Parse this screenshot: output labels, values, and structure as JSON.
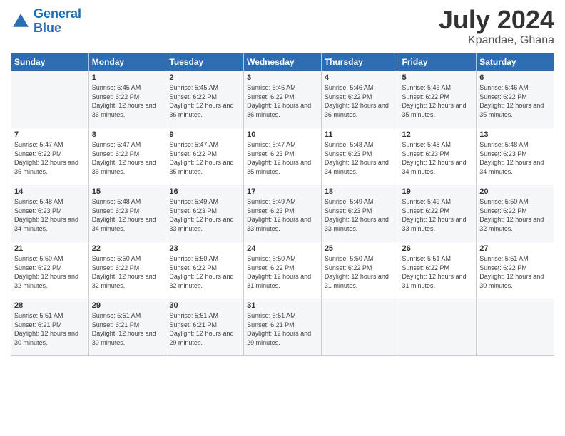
{
  "logo": {
    "line1": "General",
    "line2": "Blue"
  },
  "title": "July 2024",
  "location": "Kpandae, Ghana",
  "days_header": [
    "Sunday",
    "Monday",
    "Tuesday",
    "Wednesday",
    "Thursday",
    "Friday",
    "Saturday"
  ],
  "weeks": [
    [
      {
        "day": "",
        "sunrise": "",
        "sunset": "",
        "daylight": ""
      },
      {
        "day": "1",
        "sunrise": "Sunrise: 5:45 AM",
        "sunset": "Sunset: 6:22 PM",
        "daylight": "Daylight: 12 hours and 36 minutes."
      },
      {
        "day": "2",
        "sunrise": "Sunrise: 5:45 AM",
        "sunset": "Sunset: 6:22 PM",
        "daylight": "Daylight: 12 hours and 36 minutes."
      },
      {
        "day": "3",
        "sunrise": "Sunrise: 5:46 AM",
        "sunset": "Sunset: 6:22 PM",
        "daylight": "Daylight: 12 hours and 36 minutes."
      },
      {
        "day": "4",
        "sunrise": "Sunrise: 5:46 AM",
        "sunset": "Sunset: 6:22 PM",
        "daylight": "Daylight: 12 hours and 36 minutes."
      },
      {
        "day": "5",
        "sunrise": "Sunrise: 5:46 AM",
        "sunset": "Sunset: 6:22 PM",
        "daylight": "Daylight: 12 hours and 35 minutes."
      },
      {
        "day": "6",
        "sunrise": "Sunrise: 5:46 AM",
        "sunset": "Sunset: 6:22 PM",
        "daylight": "Daylight: 12 hours and 35 minutes."
      }
    ],
    [
      {
        "day": "7",
        "sunrise": "Sunrise: 5:47 AM",
        "sunset": "Sunset: 6:22 PM",
        "daylight": "Daylight: 12 hours and 35 minutes."
      },
      {
        "day": "8",
        "sunrise": "Sunrise: 5:47 AM",
        "sunset": "Sunset: 6:22 PM",
        "daylight": "Daylight: 12 hours and 35 minutes."
      },
      {
        "day": "9",
        "sunrise": "Sunrise: 5:47 AM",
        "sunset": "Sunset: 6:22 PM",
        "daylight": "Daylight: 12 hours and 35 minutes."
      },
      {
        "day": "10",
        "sunrise": "Sunrise: 5:47 AM",
        "sunset": "Sunset: 6:23 PM",
        "daylight": "Daylight: 12 hours and 35 minutes."
      },
      {
        "day": "11",
        "sunrise": "Sunrise: 5:48 AM",
        "sunset": "Sunset: 6:23 PM",
        "daylight": "Daylight: 12 hours and 34 minutes."
      },
      {
        "day": "12",
        "sunrise": "Sunrise: 5:48 AM",
        "sunset": "Sunset: 6:23 PM",
        "daylight": "Daylight: 12 hours and 34 minutes."
      },
      {
        "day": "13",
        "sunrise": "Sunrise: 5:48 AM",
        "sunset": "Sunset: 6:23 PM",
        "daylight": "Daylight: 12 hours and 34 minutes."
      }
    ],
    [
      {
        "day": "14",
        "sunrise": "Sunrise: 5:48 AM",
        "sunset": "Sunset: 6:23 PM",
        "daylight": "Daylight: 12 hours and 34 minutes."
      },
      {
        "day": "15",
        "sunrise": "Sunrise: 5:48 AM",
        "sunset": "Sunset: 6:23 PM",
        "daylight": "Daylight: 12 hours and 34 minutes."
      },
      {
        "day": "16",
        "sunrise": "Sunrise: 5:49 AM",
        "sunset": "Sunset: 6:23 PM",
        "daylight": "Daylight: 12 hours and 33 minutes."
      },
      {
        "day": "17",
        "sunrise": "Sunrise: 5:49 AM",
        "sunset": "Sunset: 6:23 PM",
        "daylight": "Daylight: 12 hours and 33 minutes."
      },
      {
        "day": "18",
        "sunrise": "Sunrise: 5:49 AM",
        "sunset": "Sunset: 6:23 PM",
        "daylight": "Daylight: 12 hours and 33 minutes."
      },
      {
        "day": "19",
        "sunrise": "Sunrise: 5:49 AM",
        "sunset": "Sunset: 6:22 PM",
        "daylight": "Daylight: 12 hours and 33 minutes."
      },
      {
        "day": "20",
        "sunrise": "Sunrise: 5:50 AM",
        "sunset": "Sunset: 6:22 PM",
        "daylight": "Daylight: 12 hours and 32 minutes."
      }
    ],
    [
      {
        "day": "21",
        "sunrise": "Sunrise: 5:50 AM",
        "sunset": "Sunset: 6:22 PM",
        "daylight": "Daylight: 12 hours and 32 minutes."
      },
      {
        "day": "22",
        "sunrise": "Sunrise: 5:50 AM",
        "sunset": "Sunset: 6:22 PM",
        "daylight": "Daylight: 12 hours and 32 minutes."
      },
      {
        "day": "23",
        "sunrise": "Sunrise: 5:50 AM",
        "sunset": "Sunset: 6:22 PM",
        "daylight": "Daylight: 12 hours and 32 minutes."
      },
      {
        "day": "24",
        "sunrise": "Sunrise: 5:50 AM",
        "sunset": "Sunset: 6:22 PM",
        "daylight": "Daylight: 12 hours and 31 minutes."
      },
      {
        "day": "25",
        "sunrise": "Sunrise: 5:50 AM",
        "sunset": "Sunset: 6:22 PM",
        "daylight": "Daylight: 12 hours and 31 minutes."
      },
      {
        "day": "26",
        "sunrise": "Sunrise: 5:51 AM",
        "sunset": "Sunset: 6:22 PM",
        "daylight": "Daylight: 12 hours and 31 minutes."
      },
      {
        "day": "27",
        "sunrise": "Sunrise: 5:51 AM",
        "sunset": "Sunset: 6:22 PM",
        "daylight": "Daylight: 12 hours and 30 minutes."
      }
    ],
    [
      {
        "day": "28",
        "sunrise": "Sunrise: 5:51 AM",
        "sunset": "Sunset: 6:21 PM",
        "daylight": "Daylight: 12 hours and 30 minutes."
      },
      {
        "day": "29",
        "sunrise": "Sunrise: 5:51 AM",
        "sunset": "Sunset: 6:21 PM",
        "daylight": "Daylight: 12 hours and 30 minutes."
      },
      {
        "day": "30",
        "sunrise": "Sunrise: 5:51 AM",
        "sunset": "Sunset: 6:21 PM",
        "daylight": "Daylight: 12 hours and 29 minutes."
      },
      {
        "day": "31",
        "sunrise": "Sunrise: 5:51 AM",
        "sunset": "Sunset: 6:21 PM",
        "daylight": "Daylight: 12 hours and 29 minutes."
      },
      {
        "day": "",
        "sunrise": "",
        "sunset": "",
        "daylight": ""
      },
      {
        "day": "",
        "sunrise": "",
        "sunset": "",
        "daylight": ""
      },
      {
        "day": "",
        "sunrise": "",
        "sunset": "",
        "daylight": ""
      }
    ]
  ]
}
